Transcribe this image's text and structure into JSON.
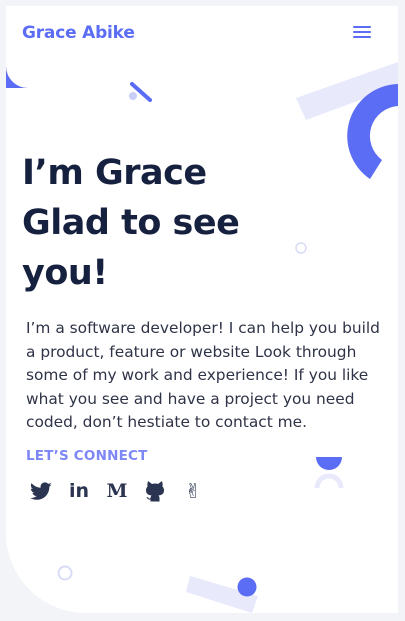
{
  "header": {
    "brand": "Grace Abike",
    "menu_icon": "hamburger-menu-icon"
  },
  "hero": {
    "title_lines": [
      "I’m Grace",
      "Glad to see",
      "you!"
    ],
    "intro": "I’m a software developer! I can help you build a product, feature or website Look through some of my work and experience! If you like what you see and have a project you need coded, don’t hestiate to contact me.",
    "connect_label": "LET’S CONNECT"
  },
  "socials": [
    {
      "name": "twitter-icon"
    },
    {
      "name": "linkedin-icon",
      "glyph": "in"
    },
    {
      "name": "medium-icon",
      "glyph": "M"
    },
    {
      "name": "github-icon"
    },
    {
      "name": "peace-hand-icon",
      "glyph": "✌"
    }
  ],
  "colors": {
    "accent": "#5b6cf5",
    "accent_light": "#e8eafc",
    "heading": "#16203f",
    "body_text": "#2f3347",
    "connect_label": "#7d87f5",
    "icon": "#2b3450"
  }
}
